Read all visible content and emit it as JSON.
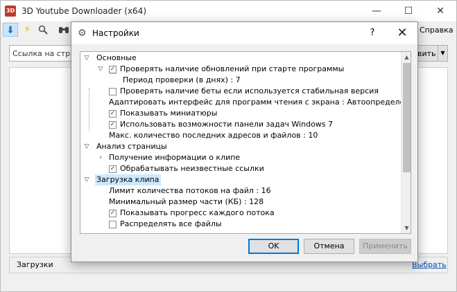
{
  "app": {
    "title": "3D Youtube Downloader (x64)",
    "icon_text": "3D",
    "window_controls": {
      "minimize": "—",
      "maximize": "☐",
      "close": "✕"
    }
  },
  "toolbar": {
    "icons": [
      "download-arrow-icon",
      "lightning-icon",
      "search-icon",
      "binoculars-icon"
    ],
    "menu_help": "Справка"
  },
  "url_bar": {
    "placeholder": "Ссылка на стран",
    "button_label": "вить",
    "dropdown_arrow": "▼"
  },
  "bottom_bar": {
    "downloads_label": "Загрузки",
    "choose_link": "Выбрать"
  },
  "dialog": {
    "title": "Настройки",
    "help": "?",
    "close": "✕",
    "tree": [
      {
        "label": "Основные",
        "type": "group",
        "expanded": true
      },
      {
        "label": "Проверять наличие обновлений при старте программы",
        "checked": true,
        "expanded": true
      },
      {
        "label": "Период проверки (в днях) : 7"
      },
      {
        "label": "Проверять наличие беты если используется стабильная версия",
        "checked": false
      },
      {
        "label": "Адаптировать интерфейс для программ чтения с экрана : Автоопределение"
      },
      {
        "label": "Показывать миниатюры",
        "checked": true
      },
      {
        "label": "Использовать возможности панели задач Windows 7",
        "checked": true
      },
      {
        "label": "Макс. количество последних адресов и файлов : 10"
      },
      {
        "label": "Анализ страницы",
        "type": "group",
        "expanded": true
      },
      {
        "label": "Получение информации о клипе",
        "expanded": false
      },
      {
        "label": "Обрабатывать неизвестные ссылки",
        "checked": true
      },
      {
        "label": "Загрузка клипа",
        "type": "group",
        "expanded": true,
        "selected": true
      },
      {
        "label": "Лимит количества потоков на файл : 16"
      },
      {
        "label": "Минимальный размер части (КБ) : 128"
      },
      {
        "label": "Показывать прогресс каждого потока",
        "checked": true
      },
      {
        "label": "Распределять все файлы",
        "checked": false
      }
    ],
    "buttons": {
      "ok": "OK",
      "cancel": "Отмена",
      "apply": "Применить"
    },
    "scrollbar_arrows": {
      "up": "▲",
      "down": "▼"
    }
  },
  "colors": {
    "selection": "#cce8ff",
    "ok_border": "#0078d7",
    "link": "#0645ad"
  }
}
